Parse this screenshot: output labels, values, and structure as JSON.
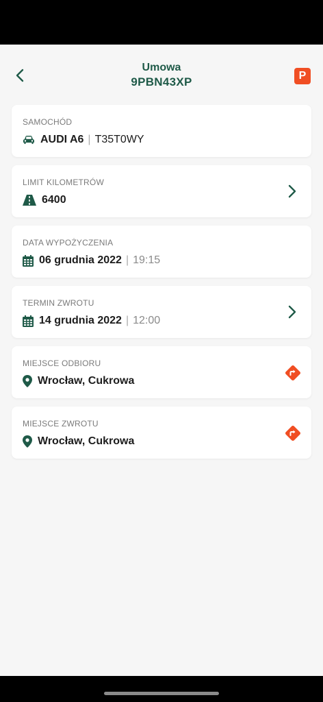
{
  "header": {
    "title": "Umowa",
    "subtitle": "9PBN43XP",
    "parking_label": "P"
  },
  "colors": {
    "accent": "#1f5a48",
    "brand_orange": "#f04e23"
  },
  "cards": {
    "car": {
      "label": "SAMOCHÓD",
      "value": "AUDI A6",
      "plate": "T35T0WY",
      "icon": "car-icon"
    },
    "km_limit": {
      "label": "LIMIT KILOMETRÓW",
      "value": "6400",
      "icon": "road-icon"
    },
    "rental_date": {
      "label": "DATA WYPOŻYCZENIA",
      "date": "06 grudnia 2022",
      "time": "19:15",
      "icon": "calendar-icon"
    },
    "return_deadline": {
      "label": "TERMIN ZWROTU",
      "date": "14 grudnia 2022",
      "time": "12:00",
      "icon": "calendar-icon"
    },
    "pickup_place": {
      "label": "MIEJSCE ODBIORU",
      "value": "Wrocław, Cukrowa",
      "icon": "location-pin-icon"
    },
    "return_place": {
      "label": "MIEJSCE ZWROTU",
      "value": "Wrocław, Cukrowa",
      "icon": "location-pin-icon"
    }
  }
}
